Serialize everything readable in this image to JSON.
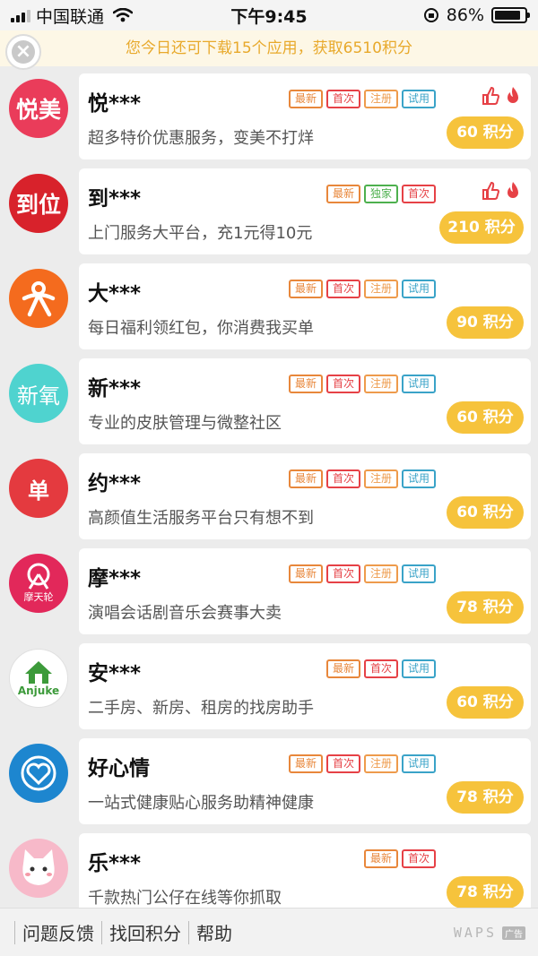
{
  "status_bar": {
    "carrier": "中国联通",
    "time": "下午9:45",
    "battery_pct": "86%",
    "battery_level": 0.86
  },
  "notice": {
    "text": "您今日还可下载15个应用，获取6510积分"
  },
  "tag_labels": {
    "new": "最新",
    "first": "首次",
    "reg": "注册",
    "trial": "试用",
    "excl": "独家"
  },
  "apps": [
    {
      "name": "悦***",
      "desc": "超多特价优惠服务，变美不打烊",
      "points": "60 积分",
      "icon_text": "悦美",
      "icon_color": "#ea3c5a",
      "hot": true
    },
    {
      "name": "到***",
      "desc": "上门服务大平台，充1元得10元",
      "points": "210 积分",
      "icon_text": "到位",
      "icon_color": "#d8222b",
      "hot": true
    },
    {
      "name": "大***",
      "desc": "每日福利领红包，你消费我买单",
      "points": "90 积分",
      "icon_text": "",
      "icon_color": "#f46b1e",
      "hot": false
    },
    {
      "name": "新***",
      "desc": "专业的皮肤管理与微整社区",
      "points": "60 积分",
      "icon_text": "新氧",
      "icon_color": "#4fd3cf",
      "hot": false
    },
    {
      "name": "约***",
      "desc": "高颜值生活服务平台只有想不到",
      "points": "60 积分",
      "icon_text": "单",
      "icon_color": "#e43a3f",
      "hot": false
    },
    {
      "name": "摩***",
      "desc": "演唱会话剧音乐会赛事大卖",
      "points": "78 积分",
      "icon_text": "摩天轮",
      "icon_color": "#e2285a",
      "hot": false
    },
    {
      "name": "安***",
      "desc": "二手房、新房、租房的找房助手",
      "points": "60 积分",
      "icon_text": "Anjuke",
      "icon_color": "#ffffff",
      "hot": false
    },
    {
      "name": "好心情",
      "desc": "一站式健康贴心服务助精神健康",
      "points": "78 积分",
      "icon_text": "",
      "icon_color": "#1d86cf",
      "hot": false
    },
    {
      "name": "乐***",
      "desc": "千款热门公仔在线等你抓取",
      "points": "78 积分",
      "icon_text": "",
      "icon_color": "#f7b9c9",
      "hot": false
    }
  ],
  "bottom_bar": {
    "feedback": "问题反馈",
    "recover": "找回积分",
    "help": "帮助",
    "brand": "WAPS",
    "ad_badge": "广告"
  }
}
